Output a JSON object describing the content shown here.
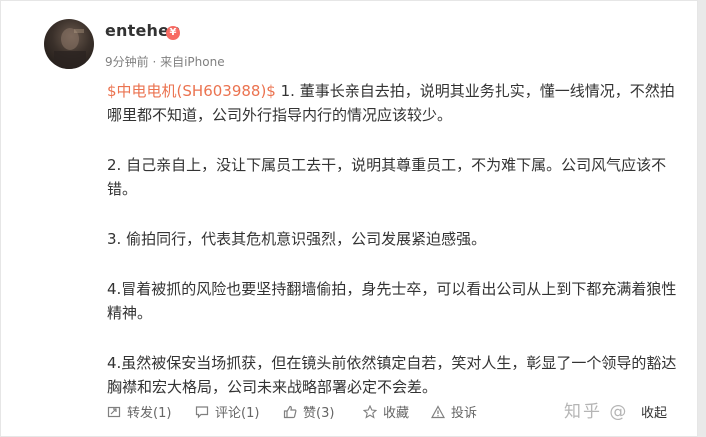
{
  "post": {
    "author": "entehen",
    "vip_badge": "¥",
    "meta": "9分钟前 · 来自iPhone",
    "stock_tag": "$中电电机(SH603988)$",
    "paragraph_1_rest": " 1. 董事长亲自去拍，说明其业务扎实，懂一线情况，不然拍哪里都不知道，公司外行指导内行的情况应该较少。",
    "paragraph_2": "2. 自己亲自上，没让下属员工去干，说明其尊重员工，不为难下属。公司风气应该不错。",
    "paragraph_3": "3. 偷拍同行，代表其危机意识强烈，公司发展紧迫感强。",
    "paragraph_4": "4.冒着被抓的风险也要坚持翻墙偷拍，身先士卒，可以看出公司从上到下都充满着狼性精神。",
    "paragraph_5": "4.虽然被保安当场抓获，但在镜头前依然镇定自若，笑对人生，彰显了一个领导的豁达胸襟和宏大格局，公司未来战略部署必定不会差。"
  },
  "actions": {
    "repost": "转发(1)",
    "comment": "评论(1)",
    "like": "赞(3)",
    "collect": "收藏",
    "report": "投诉"
  },
  "watermark": "知乎 @",
  "expand": "收起",
  "colors": {
    "link": "#eb7350",
    "text": "#333333",
    "meta": "#808080",
    "badge": "#f76b63"
  },
  "icons": [
    "repost-icon",
    "comment-icon",
    "like-icon",
    "star-icon",
    "report-icon"
  ]
}
